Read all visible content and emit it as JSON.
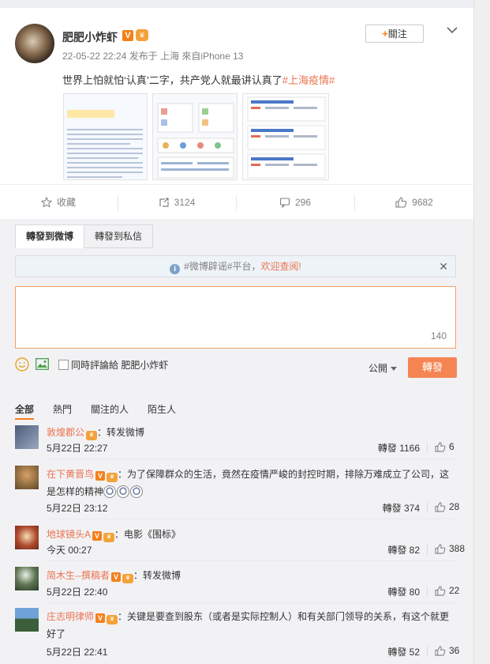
{
  "post": {
    "username": "肥肥小炸虾",
    "verified_badge": "V",
    "meta": "22-05-22 22:24 发布于 上海 來自iPhone 13",
    "text_plain": "世界上怕就怕‘认真’二字，共产党人就最讲认真了",
    "hashtag": "#上海疫情#",
    "follow_label": "關注",
    "follow_plus": "+"
  },
  "actions": {
    "favorite_label": "收藏",
    "repost_count": "3124",
    "comment_count": "296",
    "like_count": "9682"
  },
  "forward": {
    "tab_weibo": "轉發到微博",
    "tab_message": "轉發到私信",
    "notice_text": "#微博辟谣#平台，",
    "notice_highlight": "欢迎查阅!",
    "char_count": "140",
    "also_comment_label": "同時評論給 肥肥小炸虾",
    "visibility": "公開",
    "submit_label": "轉發"
  },
  "filters": [
    "全部",
    "熱門",
    "關注的人",
    "陌生人"
  ],
  "comments": [
    {
      "name": "敦煌郡公",
      "has_v": false,
      "text": "：转发微博",
      "time": "5月22日 22:27",
      "fwd": "轉發 1166",
      "likes": "6"
    },
    {
      "name": "在下黄晋鸟",
      "has_v": true,
      "text": "：为了保障群众的生活，竟然在疫情严峻的封控时期，排除万难成立了公司，这是怎样的精神",
      "time": "5月22日 23:12",
      "fwd": "轉發 374",
      "likes": "28"
    },
    {
      "name": "地球镜头A",
      "has_v": true,
      "text": "：电影《围标》",
      "time": "今天 00:27",
      "fwd": "轉發 82",
      "likes": "388"
    },
    {
      "name": "简木生--撰稿者",
      "has_v": true,
      "text": "：转发微博",
      "time": "5月22日 22:40",
      "fwd": "轉發 80",
      "likes": "22"
    },
    {
      "name": "庄志明律师",
      "has_v": true,
      "text": "：关键是要查到股东（或者是实际控制人）和有关部门领导的关系，有这个就更好了",
      "time": "5月22日 22:41",
      "fwd": "轉發 52",
      "likes": "36"
    }
  ],
  "colors": {
    "accent": "#f5801a",
    "link": "#eb7350",
    "button": "#f58552"
  }
}
